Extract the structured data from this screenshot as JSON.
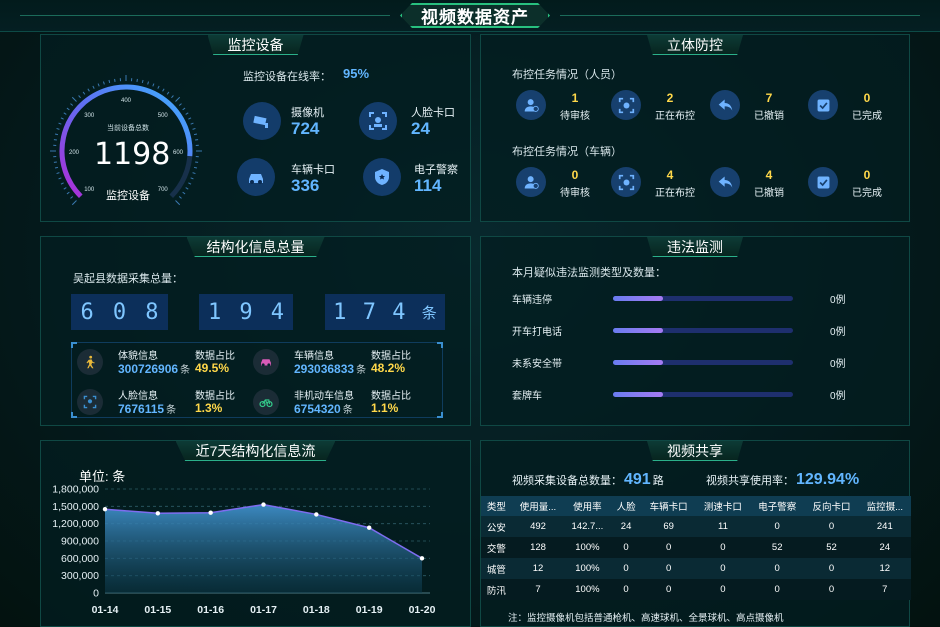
{
  "page_title": "视频数据资产",
  "monitor": {
    "title": "监控设备",
    "online_rate_label": "监控设备在线率：",
    "online_rate": "95%",
    "gauge": {
      "caption": "当前设备总数",
      "total": "1198",
      "subtitle": "监控设备",
      "ticks": [
        "100",
        "200",
        "300",
        "400",
        "500",
        "600",
        "700"
      ],
      "value_fraction": 0.85
    },
    "devices": [
      {
        "label": "摄像机",
        "value": "724",
        "icon": "camera-icon"
      },
      {
        "label": "人脸卡口",
        "value": "24",
        "icon": "face-scan-icon"
      },
      {
        "label": "车辆卡口",
        "value": "336",
        "icon": "car-icon"
      },
      {
        "label": "电子警察",
        "value": "114",
        "icon": "police-badge-icon"
      }
    ]
  },
  "defense": {
    "title": "立体防控",
    "groups": [
      {
        "label": "布控任务情况（人员）",
        "tasks": [
          {
            "num": "1",
            "label": "待审核",
            "icon": "person-pending-icon"
          },
          {
            "num": "2",
            "label": "正在布控",
            "icon": "scan-icon"
          },
          {
            "num": "7",
            "label": "已撤销",
            "icon": "undo-icon"
          },
          {
            "num": "0",
            "label": "已完成",
            "icon": "check-icon"
          }
        ]
      },
      {
        "label": "布控任务情况（车辆）",
        "tasks": [
          {
            "num": "0",
            "label": "待审核",
            "icon": "person-pending-icon"
          },
          {
            "num": "4",
            "label": "正在布控",
            "icon": "scan-icon"
          },
          {
            "num": "4",
            "label": "已撤销",
            "icon": "undo-icon"
          },
          {
            "num": "0",
            "label": "已完成",
            "icon": "check-icon"
          }
        ]
      }
    ]
  },
  "structured": {
    "title": "结构化信息总量",
    "collection_label": "吴起县数据采集总量：",
    "digit_groups": [
      [
        "6",
        "0",
        "8"
      ],
      [
        "1",
        "9",
        "4"
      ],
      [
        "1",
        "7",
        "4"
      ]
    ],
    "unit": "条",
    "stats": [
      {
        "label": "体貌信息",
        "value": "300726906",
        "unit": "条",
        "pct_label": "数据占比",
        "pct": "49.5%",
        "icon": "pedestrian-icon",
        "icon_color": "#e8b83a"
      },
      {
        "label": "车辆信息",
        "value": "293036833",
        "unit": "条",
        "pct_label": "数据占比",
        "pct": "48.2%",
        "icon": "vehicle-icon",
        "icon_color": "#d95bb8"
      },
      {
        "label": "人脸信息",
        "value": "7676115",
        "unit": "条",
        "pct_label": "数据占比",
        "pct": "1.3%",
        "icon": "face-icon",
        "icon_color": "#3a8fd0"
      },
      {
        "label": "非机动车信息",
        "value": "6754320",
        "unit": "条",
        "pct_label": "数据占比",
        "pct": "1.1%",
        "icon": "bicycle-icon",
        "icon_color": "#33c98a"
      }
    ]
  },
  "violation": {
    "title": "违法监测",
    "subtitle": "本月疑似违法监测类型及数量：",
    "items": [
      {
        "label": "车辆违停",
        "value": "0例",
        "fill": 0.28
      },
      {
        "label": "开车打电话",
        "value": "0例",
        "fill": 0.28
      },
      {
        "label": "未系安全带",
        "value": "0例",
        "fill": 0.28
      },
      {
        "label": "套牌车",
        "value": "0例",
        "fill": 0.28
      }
    ]
  },
  "flow": {
    "title": "近7天结构化信息流",
    "unit_label": "单位: 条"
  },
  "chart_data": {
    "type": "area",
    "title": "近7天结构化信息流",
    "ylabel": "单位: 条",
    "categories": [
      "01-14",
      "01-15",
      "01-16",
      "01-17",
      "01-18",
      "01-19",
      "01-20"
    ],
    "values": [
      1450000,
      1380000,
      1390000,
      1530000,
      1360000,
      1130000,
      600000
    ],
    "yticks": [
      "0",
      "300,000",
      "600,000",
      "900,000",
      "1,200,000",
      "1,500,000",
      "1,800,000"
    ],
    "ylim": [
      0,
      1800000
    ],
    "grid": true,
    "line_color": "#7e6df0"
  },
  "share": {
    "title": "视频共享",
    "collect_label": "视频采集设备总数量：",
    "collect_value": "491",
    "collect_unit": "路",
    "usage_label": "视频共享使用率：",
    "usage_value": "129.94%",
    "headers": [
      "类型",
      "使用量...",
      "使用率",
      "人脸",
      "车辆卡口",
      "测速卡口",
      "电子警察",
      "反向卡口",
      "监控摄..."
    ],
    "rows": [
      [
        "公安",
        "492",
        "142.7...",
        "24",
        "69",
        "11",
        "0",
        "0",
        "241"
      ],
      [
        "交警",
        "128",
        "100%",
        "0",
        "0",
        "0",
        "52",
        "52",
        "24"
      ],
      [
        "城管",
        "12",
        "100%",
        "0",
        "0",
        "0",
        "0",
        "0",
        "12"
      ],
      [
        "防汛",
        "7",
        "100%",
        "0",
        "0",
        "0",
        "0",
        "0",
        "7"
      ]
    ],
    "note": "注：监控摄像机包括普通枪机、高速球机、全景球机、高点摄像机"
  }
}
